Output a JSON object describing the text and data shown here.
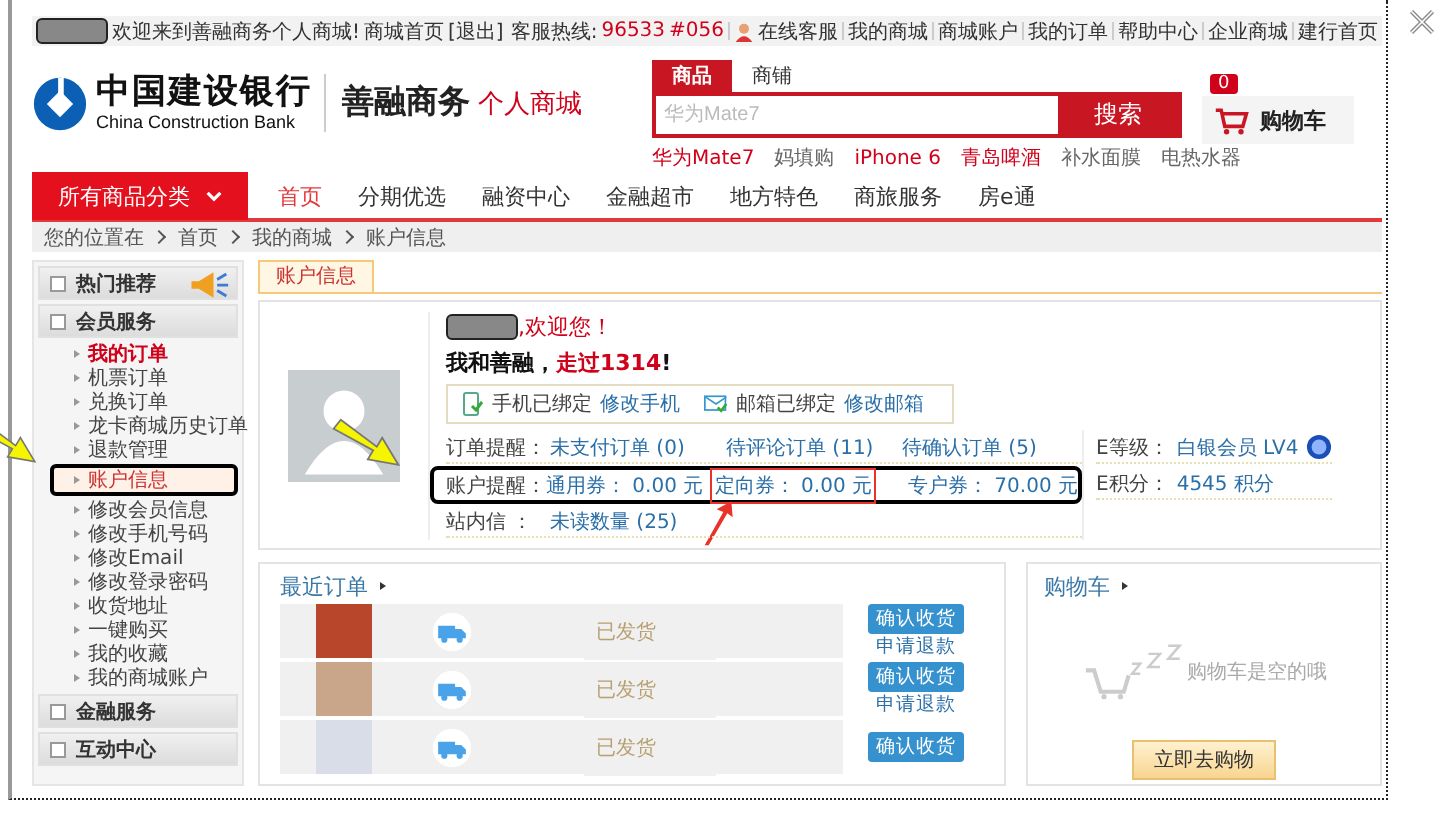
{
  "top_bar": {
    "greeting": "欢迎来到善融商务个人商城!",
    "links_left": [
      "商城首页",
      "[退出]"
    ],
    "hotline_label": "客服热线:",
    "hotline": "96533",
    "extension": "#056",
    "online_service": "在线客服",
    "links_right": [
      "我的商城",
      "商城账户",
      "我的订单",
      "帮助中心",
      "企业商城",
      "建行首页"
    ]
  },
  "logo": {
    "name_cn": "中国建设银行",
    "name_en": "China Construction Bank",
    "brand": "善融商务",
    "sub_brand": "个人商城"
  },
  "search": {
    "tabs": [
      {
        "label": "商品",
        "selected": true
      },
      {
        "label": "商铺",
        "selected": false
      }
    ],
    "placeholder": "华为Mate7",
    "button": "搜索",
    "hot_words": [
      {
        "text": "华为Mate7",
        "highlight": true
      },
      {
        "text": "妈填购",
        "highlight": false
      },
      {
        "text": "iPhone 6",
        "highlight": true
      },
      {
        "text": "青岛啤酒",
        "highlight": true
      },
      {
        "text": "补水面膜",
        "highlight": false
      },
      {
        "text": "电热水器",
        "highlight": false
      }
    ]
  },
  "cart": {
    "count": "0",
    "label": "购物车"
  },
  "nav": {
    "categories": "所有商品分类",
    "items": [
      {
        "label": "首页",
        "selected": true
      },
      {
        "label": "分期优选",
        "selected": false
      },
      {
        "label": "融资中心",
        "selected": false
      },
      {
        "label": "金融超市",
        "selected": false
      },
      {
        "label": "地方特色",
        "selected": false
      },
      {
        "label": "商旅服务",
        "selected": false
      },
      {
        "label": "房e通",
        "selected": false
      }
    ]
  },
  "breadcrumb": {
    "label": "您的位置在",
    "items": [
      "首页",
      "我的商城",
      "账户信息"
    ]
  },
  "sidebar": [
    {
      "title": "热门推荐"
    },
    {
      "title": "会员服务",
      "items": [
        {
          "label": "我的订单",
          "highlight": true,
          "selected": false,
          "callout": false
        },
        {
          "label": "机票订单",
          "highlight": false,
          "selected": false,
          "callout": false
        },
        {
          "label": "兑换订单",
          "highlight": false,
          "selected": false,
          "callout": false
        },
        {
          "label": "龙卡商城历史订单",
          "highlight": false,
          "selected": false,
          "callout": false
        },
        {
          "label": "退款管理",
          "highlight": false,
          "selected": false,
          "callout": false
        },
        {
          "label": "账户信息",
          "highlight": false,
          "selected": true,
          "callout": true
        },
        {
          "label": "修改会员信息",
          "highlight": false,
          "selected": false,
          "callout": false
        },
        {
          "label": "修改手机号码",
          "highlight": false,
          "selected": false,
          "callout": false
        },
        {
          "label": "修改Email",
          "highlight": false,
          "selected": false,
          "callout": false
        },
        {
          "label": "修改登录密码",
          "highlight": false,
          "selected": false,
          "callout": false
        },
        {
          "label": "收货地址",
          "highlight": false,
          "selected": false,
          "callout": false
        },
        {
          "label": "一键购买",
          "highlight": false,
          "selected": false,
          "callout": false
        },
        {
          "label": "我的收藏",
          "highlight": false,
          "selected": false,
          "callout": false
        },
        {
          "label": "我的商城账户",
          "highlight": false,
          "selected": false,
          "callout": false
        }
      ]
    },
    {
      "title": "金融服务"
    },
    {
      "title": "互动中心"
    }
  ],
  "account_tab": "账户信息",
  "profile": {
    "welcome": ",欢迎您！",
    "motto": "我和善融，",
    "motto_highlight": "走过1314",
    "motto_end": "!",
    "bindings": [
      {
        "status": "手机已绑定",
        "action": "修改手机"
      },
      {
        "status": "邮箱已绑定",
        "action": "修改邮箱"
      }
    ],
    "rows": [
      {
        "label": "订单提醒：",
        "callout": false,
        "items": [
          {
            "text": "未支付订单 (0)",
            "marked": false
          },
          {
            "text": "待评论订单 (11)",
            "marked": false
          },
          {
            "text": "待确认订单 (5)",
            "marked": false
          }
        ]
      },
      {
        "label": "账户提醒：",
        "callout": true,
        "items": [
          {
            "text": "通用券： 0.00 元",
            "marked": false
          },
          {
            "text": "定向券： 0.00 元",
            "marked": true
          },
          {
            "text": "专户券： 70.00 元",
            "marked": false
          }
        ]
      },
      {
        "label": "站内信  ：",
        "callout": false,
        "items": [
          {
            "text": "未读数量 (25)",
            "marked": false
          }
        ]
      }
    ],
    "level_label": "E等级：",
    "level": "白银会员 LV4",
    "points_label": "E积分：",
    "points": "4545 积分"
  },
  "recent_orders": {
    "title": "最近订单",
    "rows": [
      {
        "status": "已发货",
        "button": "确认收货",
        "link": "申请退款"
      },
      {
        "status": "已发货",
        "button": "确认收货",
        "link": "申请退款"
      },
      {
        "status": "已发货",
        "button": "确认收货"
      }
    ]
  },
  "cart_panel": {
    "title": "购物车",
    "empty": "购物车是空的哦",
    "button": "立即去购物"
  }
}
